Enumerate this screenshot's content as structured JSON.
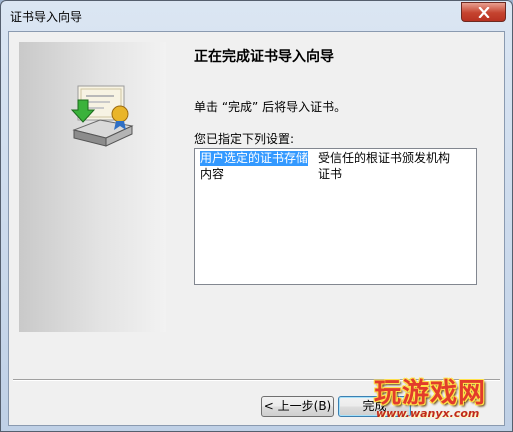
{
  "window": {
    "title": "证书导入向导",
    "close_icon": "close-icon"
  },
  "wizard": {
    "icon": "certificate-import-icon",
    "heading": "正在完成证书导入向导",
    "instruction": "单击 “完成” 后将导入证书。",
    "settings_label": "您已指定下列设置:",
    "settings": [
      {
        "name": "用户选定的证书存储",
        "value": "受信任的根证书颁发机构",
        "selected": true
      },
      {
        "name": "内容",
        "value": "证书",
        "selected": false
      }
    ]
  },
  "buttons": {
    "back": "< 上一步(B)",
    "finish": "完成"
  },
  "watermark": {
    "text": "玩游戏网",
    "url": "www.wanyx.com"
  },
  "colors": {
    "selection": "#3399ff",
    "close_button": "#c5432f"
  }
}
